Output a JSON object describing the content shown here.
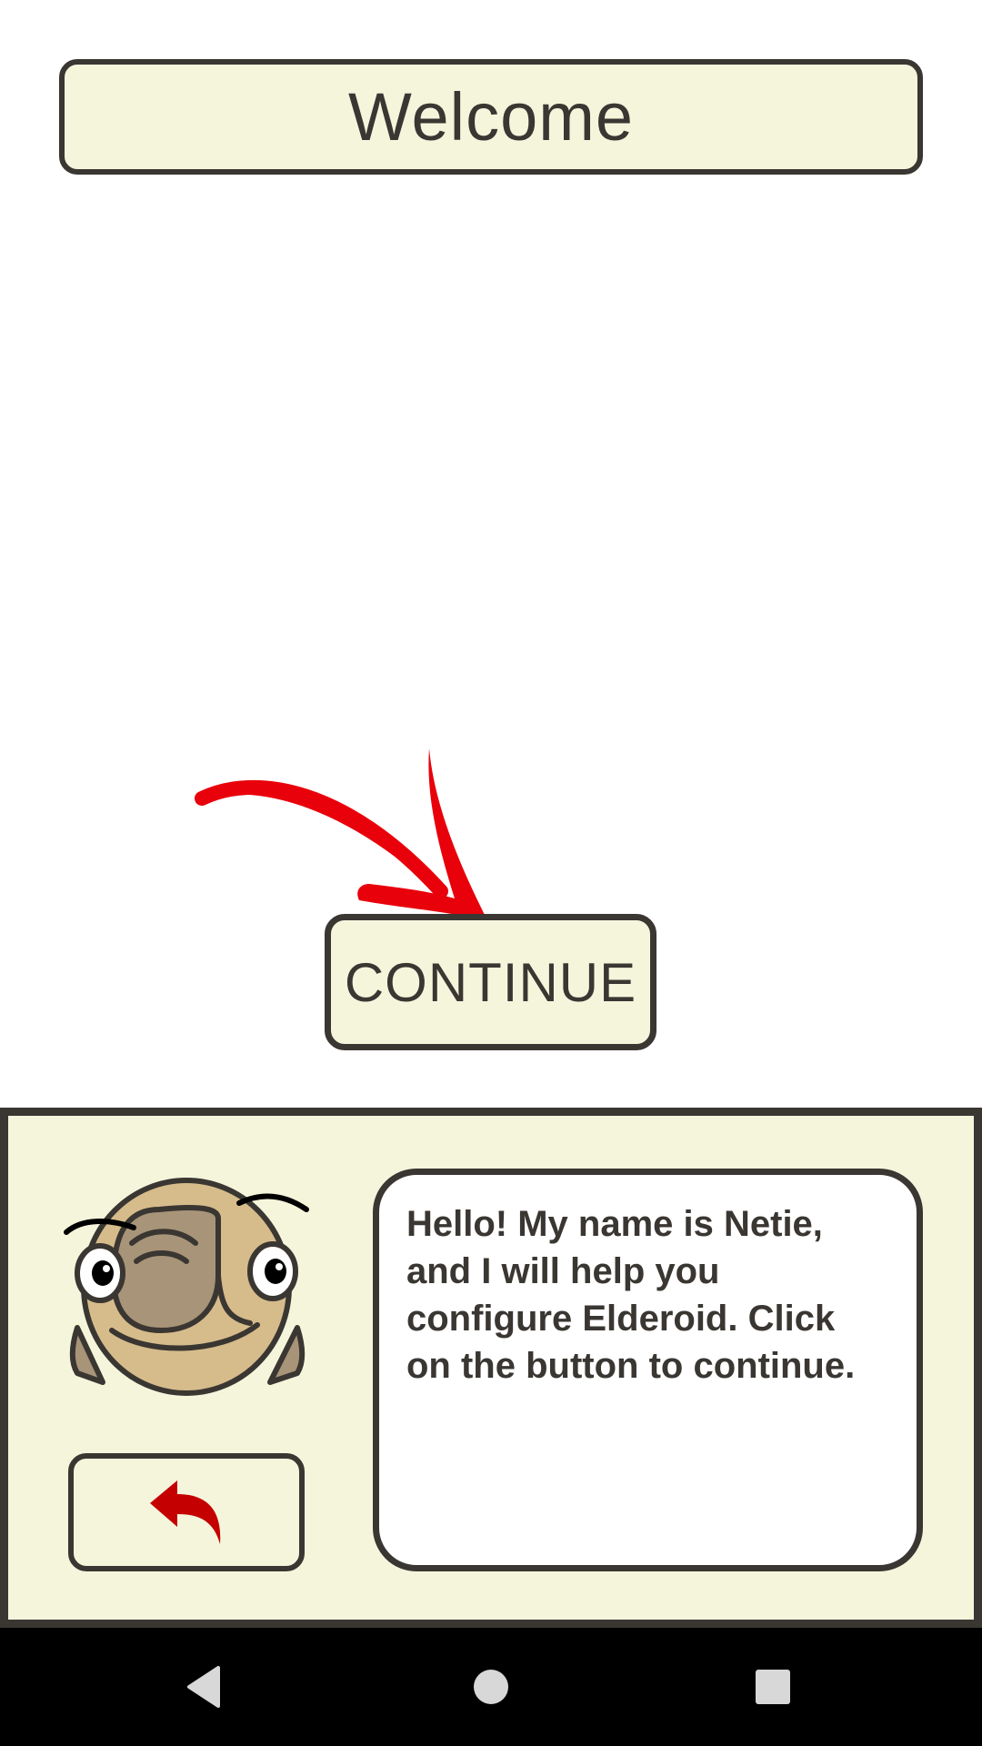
{
  "header": {
    "title": "Welcome"
  },
  "main": {
    "continue_label": "CONTINUE"
  },
  "helper": {
    "message": "Hello! My name is Netie, and I will help you configure Elderoid. Click on the button to continue.",
    "avatar_icon": "owl-avatar-icon",
    "back_icon": "undo-arrow-icon"
  },
  "nav": {
    "back_icon": "nav-back-icon",
    "home_icon": "nav-home-icon",
    "recents_icon": "nav-recents-icon"
  },
  "colors": {
    "panel_background": "#f5f5dc",
    "border": "#3a3632",
    "accent_red": "#e8000b",
    "back_icon_red": "#c40000",
    "nav_background": "#000000"
  }
}
